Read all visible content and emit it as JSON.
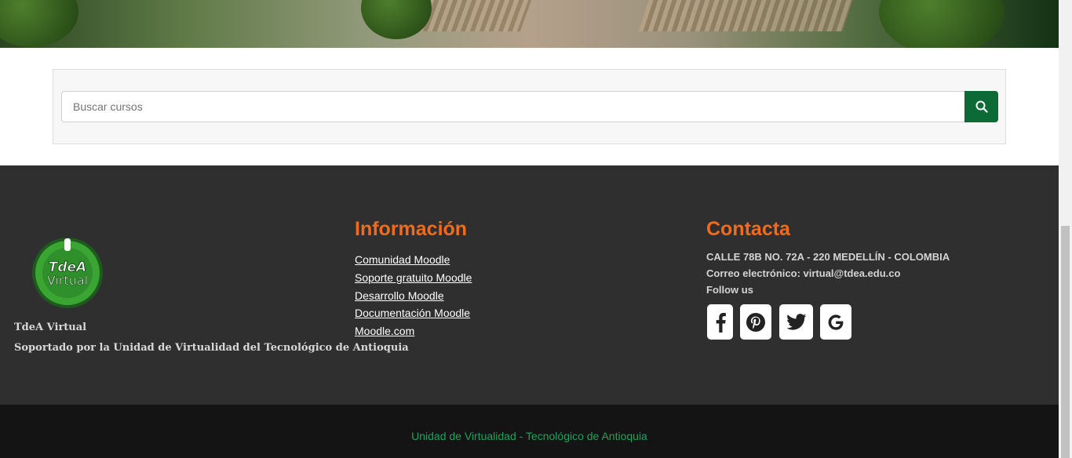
{
  "search": {
    "placeholder": "Buscar cursos"
  },
  "footer": {
    "brand": {
      "logo_text_line1": "TdeA",
      "logo_text_line2": "Virtual",
      "name": "TdeA Virtual",
      "description": "Soportado por la Unidad de Virtualidad del Tecnológico de Antioquia"
    },
    "info": {
      "title": "Información",
      "links": [
        "Comunidad Moodle",
        "Soporte gratuito Moodle",
        "Desarrollo Moodle",
        "Documentación Moodle",
        "Moodle.com"
      ]
    },
    "contact": {
      "title": "Contacta",
      "address": "CALLE 78B NO. 72A - 220 MEDELLÍN - COLOMBIA",
      "email": "Correo electrónico: virtual@tdea.edu.co",
      "follow_label": "Follow us",
      "social": [
        "facebook-icon",
        "pinterest-icon",
        "twitter-icon",
        "google-icon"
      ]
    }
  },
  "bottom_bar": {
    "text": "Unidad de Virtualidad - Tecnológico de Antioquia"
  },
  "colors": {
    "accent_orange": "#f26b1d",
    "brand_green": "#0b6a35",
    "bottom_text_green": "#1fa35a",
    "footer_bg": "#2f2f2f"
  }
}
